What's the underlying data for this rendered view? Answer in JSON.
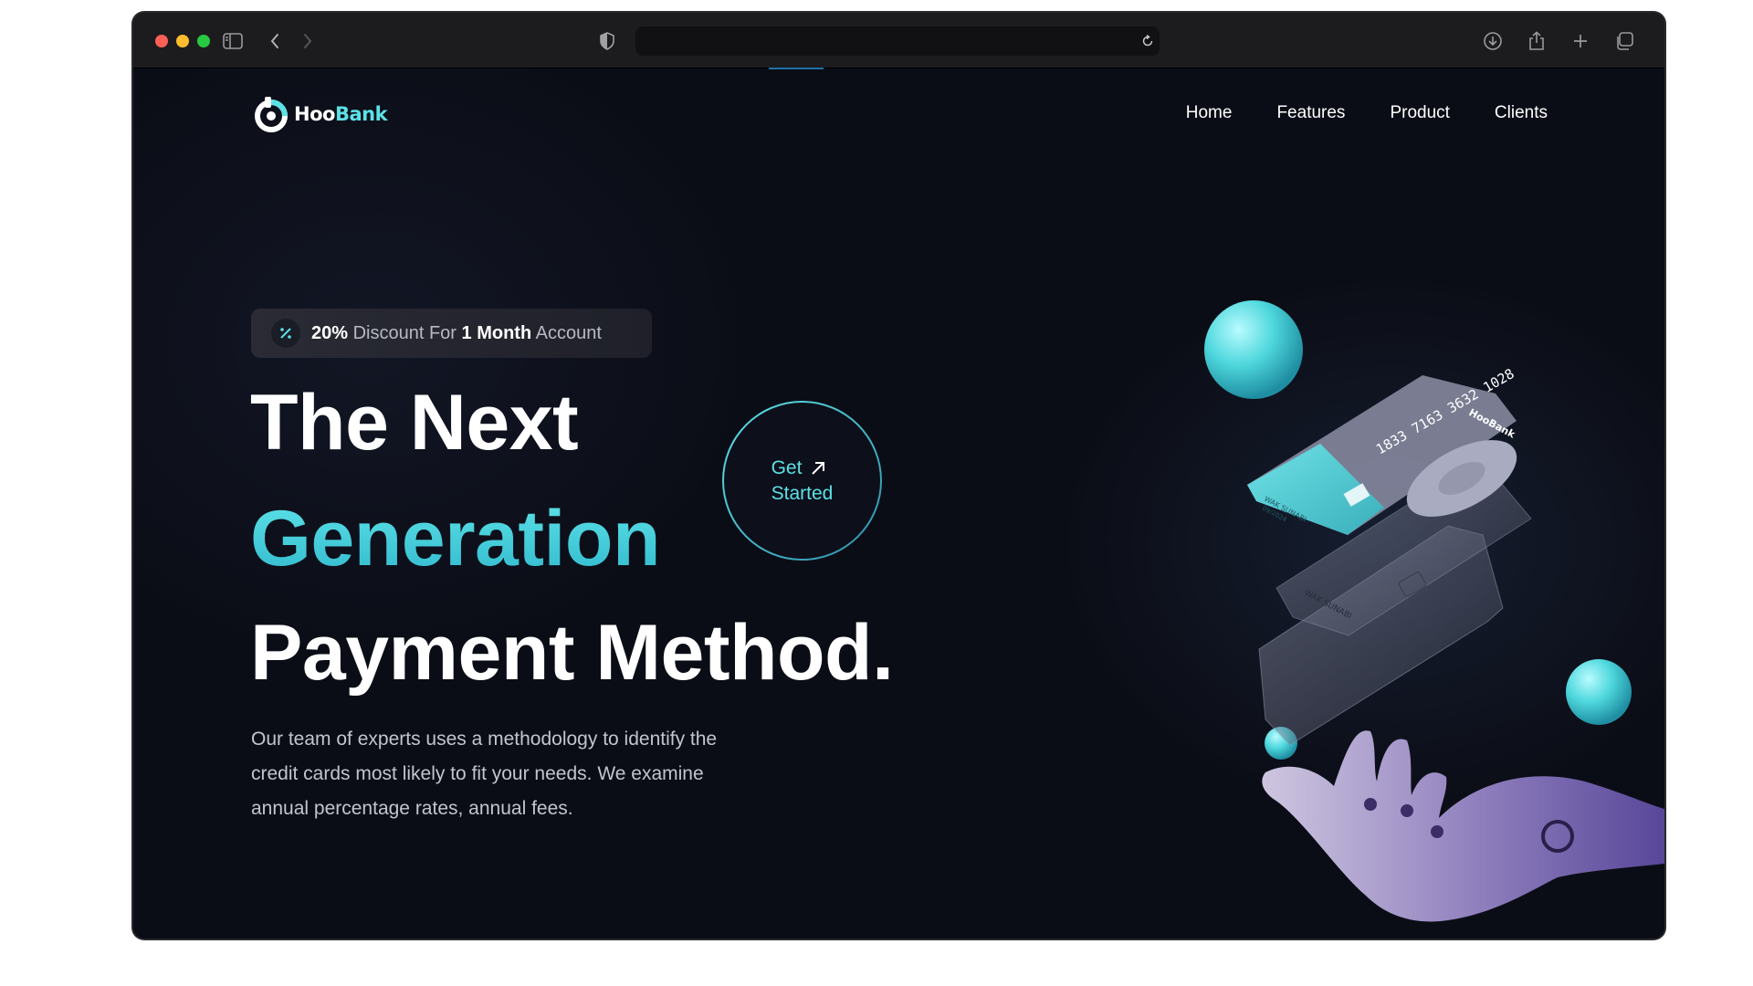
{
  "browser": {
    "icons": [
      "sidebar-toggle-icon",
      "back-icon",
      "forward-icon",
      "shield-icon",
      "reload-icon",
      "download-icon",
      "share-icon",
      "new-tab-icon",
      "tabs-overview-icon"
    ],
    "address": ""
  },
  "logo": {
    "prefix": "Hoo",
    "suffix": "Bank"
  },
  "nav": {
    "items": [
      "Home",
      "Features",
      "Product",
      "Clients"
    ]
  },
  "badge": {
    "icon": "discount-icon",
    "discount": "20%",
    "text1": " Discount For ",
    "month_num": "1",
    "month_word": " Month",
    "text2": " Account"
  },
  "hero": {
    "line1": "The Next",
    "line2": "Generation",
    "line3": "Payment Method."
  },
  "cta": {
    "line1": "Get",
    "line2": "Started",
    "icon": "arrow-up-right-icon"
  },
  "description": "Our team of experts uses a methodology to identify the credit cards most likely to fit your needs. We examine annual percentage rates, annual fees.",
  "card": {
    "number": "1833 7163 3632 1028",
    "holder": "WAK SUNABI",
    "brand": "HooBank",
    "expiry": "09/2024"
  },
  "colors": {
    "accent": "#5ce1e6",
    "background": "#0b0d16",
    "text": "#ffffff"
  }
}
